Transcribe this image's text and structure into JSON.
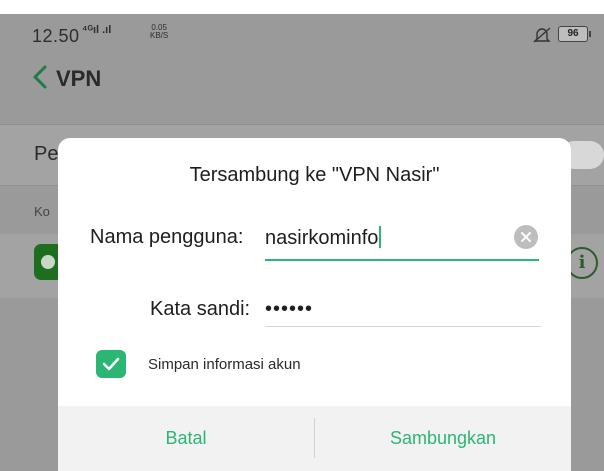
{
  "status_bar": {
    "time": "12.50",
    "signal": "⁴ᴳıl .ıl",
    "speed_top": "0.05",
    "speed_bottom": "KB/S",
    "battery": "96"
  },
  "nav": {
    "title": "VPN"
  },
  "background_list": {
    "row1_label": "Pe",
    "section_label": "Ko"
  },
  "dialog": {
    "title": "Tersambung ke \"VPN Nasir\"",
    "username_label": "Nama pengguna:",
    "username_value": "nasirkominfo",
    "password_label": "Kata sandi:",
    "password_value": "••••••",
    "save_checkbox_label": "Simpan informasi akun",
    "save_checked": true,
    "cancel_label": "Batal",
    "connect_label": "Sambungkan"
  },
  "colors": {
    "accent": "#2bb673",
    "overlay": "#9a9a9a"
  },
  "icons": {
    "back": "chevron-left-icon",
    "clear": "clear-icon",
    "info": "info-icon",
    "mute": "mute-icon",
    "checkbox": "checkmark-icon"
  }
}
